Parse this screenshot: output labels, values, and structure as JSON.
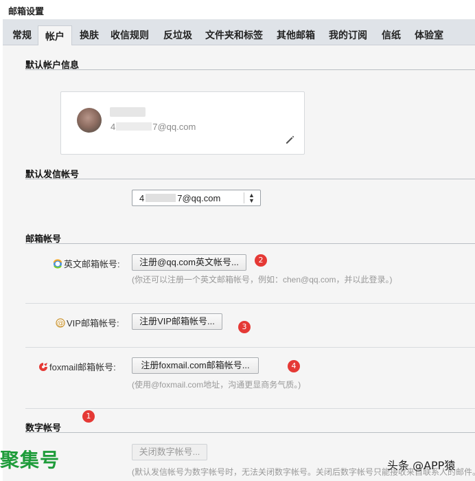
{
  "page_title": "邮箱设置",
  "tabs": [
    {
      "label": "常规"
    },
    {
      "label": "帐户"
    },
    {
      "label": "换肤"
    },
    {
      "label": "收信规则"
    },
    {
      "label": "反垃圾"
    },
    {
      "label": "文件夹和标签"
    },
    {
      "label": "其他邮箱"
    },
    {
      "label": "我的订阅"
    },
    {
      "label": "信纸"
    },
    {
      "label": "体验室"
    }
  ],
  "active_tab": "帐户",
  "default_account": {
    "title": "默认帐户信息",
    "email_prefix": "4",
    "email_suffix": "7@qq.com"
  },
  "default_sender": {
    "title": "默认发信帐号",
    "select_prefix": "4",
    "select_suffix": "7@qq.com"
  },
  "mailbox_accounts": {
    "title": "邮箱帐号",
    "english": {
      "label": "英文邮箱帐号:",
      "button": "注册@qq.com英文帐号...",
      "hint": "(你还可以注册一个英文邮箱帐号，例如：chen@qq.com，并以此登录。)",
      "badge": "2"
    },
    "vip": {
      "label": "VIP邮箱帐号:",
      "button": "注册VIP邮箱帐号...",
      "badge": "3"
    },
    "foxmail": {
      "label": "foxmail邮箱帐号:",
      "button": "注册foxmail.com邮箱帐号...",
      "hint": "(使用@foxmail.com地址，沟通更显商务气质。)",
      "badge": "4"
    }
  },
  "digital_account": {
    "title": "数字帐号",
    "badge": "1",
    "button": "关闭数字帐号...",
    "hint": "(默认发信帐号为数字帐号时，无法关闭数字帐号。关闭后数字帐号只能接收来自联系人的邮件。"
  },
  "watermarks": {
    "left": "聚集号",
    "right": "头条 @APP猿"
  },
  "colors": {
    "badge": "#e53935",
    "tab_bar": "#dfe3e8",
    "content_bg": "#f5f5f5",
    "watermark_green": "#1e9c3a"
  },
  "icons": {
    "edit": "pencil-icon",
    "english": "qq-mail-globe-icon",
    "vip": "vip-at-icon",
    "foxmail": "foxmail-icon"
  }
}
